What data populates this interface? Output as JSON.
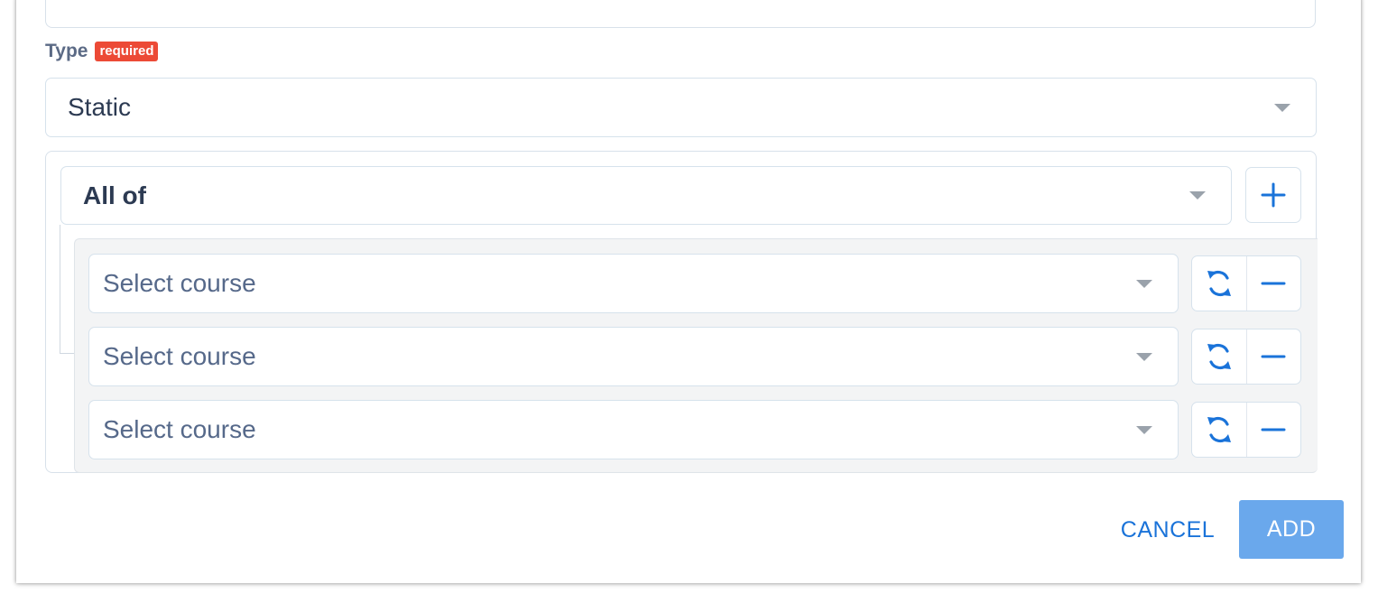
{
  "form": {
    "type_field": {
      "label": "Type",
      "badge": "required",
      "value": "Static"
    },
    "rule_group": {
      "operator": "All of",
      "course_selects": [
        {
          "placeholder": "Select course"
        },
        {
          "placeholder": "Select course"
        },
        {
          "placeholder": "Select course"
        }
      ]
    }
  },
  "footer": {
    "cancel_label": "CANCEL",
    "add_label": "ADD"
  },
  "colors": {
    "accent": "#1a73d9",
    "badge": "#ec4a36",
    "add_button": "#6aa8ec"
  },
  "icons": {
    "add": "plus-icon",
    "swap": "sync-icon",
    "remove": "minus-icon",
    "dropdown": "chevron-down-icon"
  }
}
